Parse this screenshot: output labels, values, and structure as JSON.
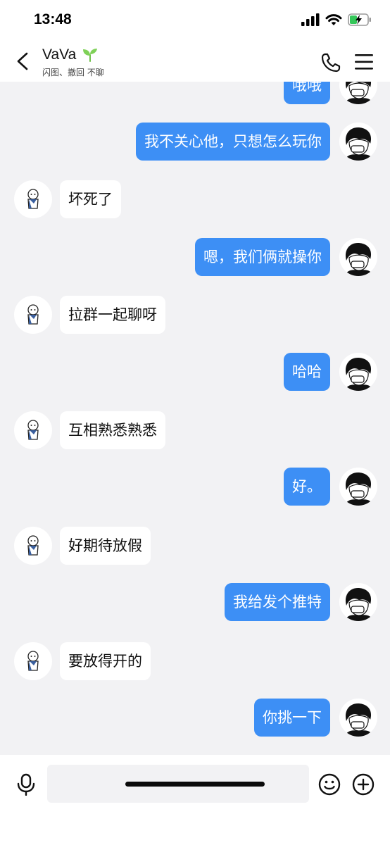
{
  "status": {
    "time": "13:48"
  },
  "header": {
    "name": "VaVa",
    "subtitle": "闪图、撤回 不聊"
  },
  "messages": [
    {
      "side": "out",
      "text": "哦哦"
    },
    {
      "side": "out",
      "text": "我不关心他，只想怎么玩你"
    },
    {
      "side": "in",
      "text": "坏死了"
    },
    {
      "side": "out",
      "text": "嗯，我们俩就操你"
    },
    {
      "side": "in",
      "text": "拉群一起聊呀"
    },
    {
      "side": "out",
      "text": "哈哈"
    },
    {
      "side": "in",
      "text": "互相熟悉熟悉"
    },
    {
      "side": "out",
      "text": "好。"
    },
    {
      "side": "in",
      "text": "好期待放假"
    },
    {
      "side": "out",
      "text": "我给发个推特"
    },
    {
      "side": "in",
      "text": "要放得开的"
    },
    {
      "side": "out",
      "text": "你挑一下"
    }
  ],
  "input": {
    "value": "",
    "placeholder": ""
  },
  "colors": {
    "outgoing_bubble": "#3d8ff5",
    "incoming_bubble": "#ffffff",
    "background": "#f2f2f4"
  }
}
